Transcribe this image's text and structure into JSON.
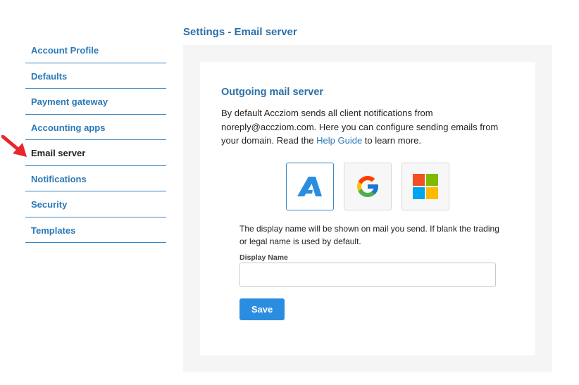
{
  "sidebar": {
    "items": [
      {
        "label": "Account Profile"
      },
      {
        "label": "Defaults"
      },
      {
        "label": "Payment gateway"
      },
      {
        "label": "Accounting apps"
      },
      {
        "label": "Email server",
        "active": true
      },
      {
        "label": "Notifications"
      },
      {
        "label": "Security"
      },
      {
        "label": "Templates"
      }
    ]
  },
  "header": {
    "title": "Settings - Email server"
  },
  "main": {
    "section_title": "Outgoing mail server",
    "description_before": "By default Accziom sends all client notifications from noreply@accziom.com. Here you can configure sending emails from your domain. Read the ",
    "help_link": "Help Guide",
    "description_after": " to learn more.",
    "providers": [
      {
        "icon": "accziom-logo-icon",
        "selected": true
      },
      {
        "icon": "google-logo-icon",
        "selected": false
      },
      {
        "icon": "microsoft-logo-icon",
        "selected": false
      }
    ],
    "hint": "The display name will be shown on mail you send. If blank the trading or legal name is used by default.",
    "display_name_label": "Display Name",
    "display_name_value": "",
    "save_label": "Save"
  },
  "colors": {
    "accent": "#2a79b8",
    "button": "#2b8de0",
    "arrow": "#e8262b"
  }
}
